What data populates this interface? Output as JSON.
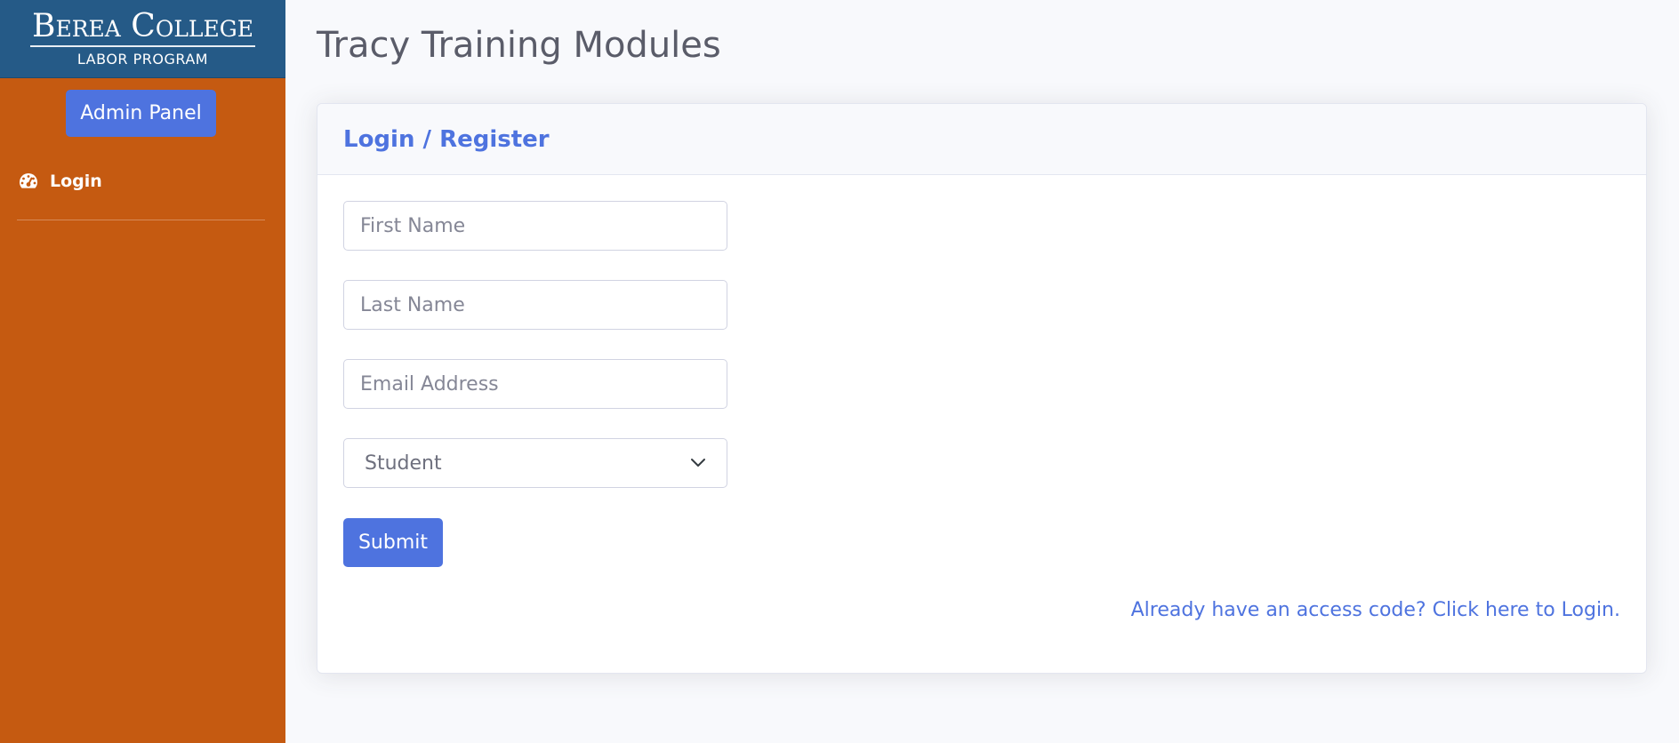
{
  "sidebar": {
    "brand_title": "Berea College",
    "brand_subtitle": "LABOR PROGRAM",
    "admin_button_label": "Admin Panel",
    "nav_items": [
      {
        "label": "Login",
        "icon": "tachometer-icon"
      }
    ]
  },
  "main": {
    "page_title": "Tracy Training Modules",
    "card": {
      "header_title": "Login / Register",
      "fields": {
        "first_name_placeholder": "First Name",
        "last_name_placeholder": "Last Name",
        "email_placeholder": "Email Address",
        "role_selected": "Student"
      },
      "submit_label": "Submit",
      "access_link_text": "Already have an access code? Click here to Login."
    }
  },
  "colors": {
    "sidebar_bg": "#c55a11",
    "brand_bg": "#255a87",
    "accent": "#4e73df",
    "page_bg": "#f8f9fc",
    "title_text": "#5a5c69"
  }
}
